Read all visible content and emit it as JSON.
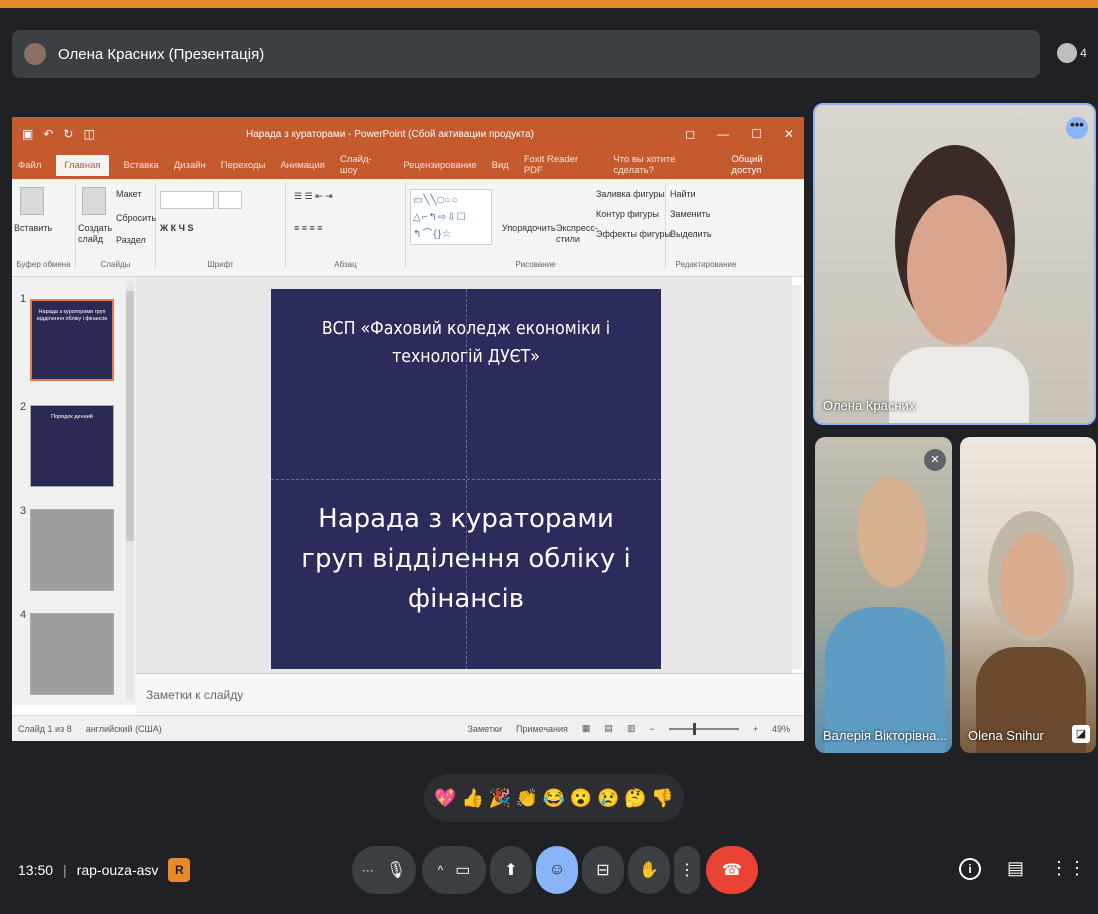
{
  "presenter": {
    "title": "Олена Красних (Презентація)",
    "participant_count": "4"
  },
  "ppt": {
    "window_title": "Нарада з кураторами - PowerPoint (Сбой активации продукта)",
    "tabs": [
      "Файл",
      "Главная",
      "Вставка",
      "Дизайн",
      "Переходы",
      "Анимация",
      "Слайд-шоу",
      "Рецензирование",
      "Вид",
      "Foxit Reader PDF",
      "Что вы хотите сделать?"
    ],
    "share": "Общий доступ",
    "ribbon": {
      "paste": "Вставить",
      "clipboard": "Буфер обмена",
      "new_slide": "Создать слайд",
      "layout": "Макет",
      "reset": "Сбросить",
      "section": "Раздел",
      "slides": "Слайды",
      "font": "Шрифт",
      "paragraph": "Абзац",
      "arrange": "Упорядочить",
      "quick_styles": "Экспресс-стили",
      "shape_fill": "Заливка фигуры",
      "shape_outline": "Контур фигуры",
      "shape_effects": "Эффекты фигуры",
      "drawing": "Рисование",
      "find": "Найти",
      "replace": "Заменить",
      "select": "Выделить",
      "editing": "Редактирование"
    },
    "thumbs": [
      {
        "num": "1",
        "text": "Нарада з кураторами груп відділення обліку і фінансів"
      },
      {
        "num": "2",
        "text": "Порядок денний"
      },
      {
        "num": "3",
        "text": ""
      },
      {
        "num": "4",
        "text": ""
      }
    ],
    "slide": {
      "subtitle": "ВСП «Фаховий коледж економіки і технологій ДУЄТ»",
      "title": "Нарада з кураторами груп відділення обліку і фінансів"
    },
    "notes_placeholder": "Заметки к слайду",
    "status": {
      "slide_counter": "Слайд 1 из 8",
      "language": "английский (США)",
      "notes": "Заметки",
      "comments": "Примечания",
      "zoom": "49%"
    }
  },
  "participants": [
    {
      "name": "Олена Красних"
    },
    {
      "name": "Валерія Вікторівна..."
    },
    {
      "name": "Olena Snihur"
    }
  ],
  "reactions": [
    "💖",
    "👍",
    "🎉",
    "👏",
    "😂",
    "😮",
    "😢",
    "🤔",
    "👎"
  ],
  "meeting": {
    "time": "13:50",
    "code": "rap-ouza-asv",
    "badge": "R"
  }
}
